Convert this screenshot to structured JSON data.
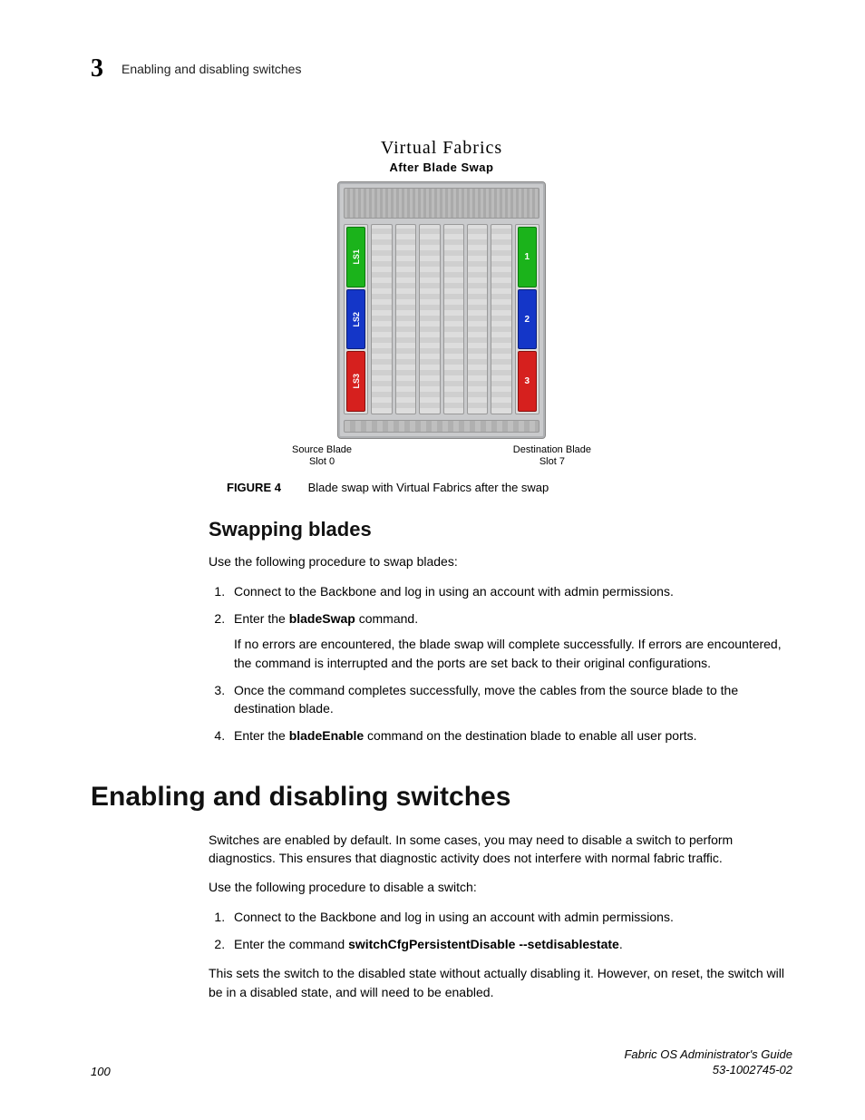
{
  "header": {
    "chapter_number": "3",
    "section_title": "Enabling and disabling switches"
  },
  "figure": {
    "title": "Virtual Fabrics",
    "subtitle": "After Blade Swap",
    "source_seg1": "LS1",
    "source_seg2": "LS2",
    "source_seg3": "LS3",
    "dest_seg1": "1",
    "dest_seg2": "2",
    "dest_seg3": "3",
    "src_label_l1": "Source Blade",
    "src_label_l2": "Slot 0",
    "dst_label_l1": "Destination Blade",
    "dst_label_l2": "Slot 7",
    "caption_num": "FIGURE 4",
    "caption_text": "Blade swap with Virtual Fabrics after the swap"
  },
  "swapping": {
    "heading": "Swapping blades",
    "intro": "Use the following procedure to swap blades:",
    "step1": "Connect to the Backbone and log in using an account with admin permissions.",
    "step2_pre": "Enter the ",
    "step2_bold": "bladeSwap",
    "step2_post": " command.",
    "step2_detail": "If no errors are encountered, the blade swap will complete successfully. If errors are encountered, the command is interrupted and the ports are set back to their original configurations.",
    "step3": "Once the command completes successfully, move the cables from the source blade to the destination blade.",
    "step4_pre": "Enter the ",
    "step4_bold": "bladeEnable",
    "step4_post": " command on the destination blade to enable all user ports."
  },
  "enabling": {
    "heading": "Enabling and disabling switches",
    "para1": "Switches are enabled by default. In some cases, you may need to disable a switch to perform diagnostics. This ensures that diagnostic activity does not interfere with normal fabric traffic.",
    "intro": "Use the following procedure to disable a switch:",
    "step1": "Connect to the Backbone and log in using an account with admin permissions.",
    "step2_pre": "Enter the command ",
    "step2_bold": "switchCfgPersistentDisable --setdisablestate",
    "step2_post": ".",
    "para2": "This sets the switch to the disabled state without actually disabling it. However, on reset, the switch will be in a disabled state, and will need to be enabled."
  },
  "footer": {
    "page_number": "100",
    "doc_title": "Fabric OS Administrator's Guide",
    "doc_id": "53-1002745-02"
  }
}
